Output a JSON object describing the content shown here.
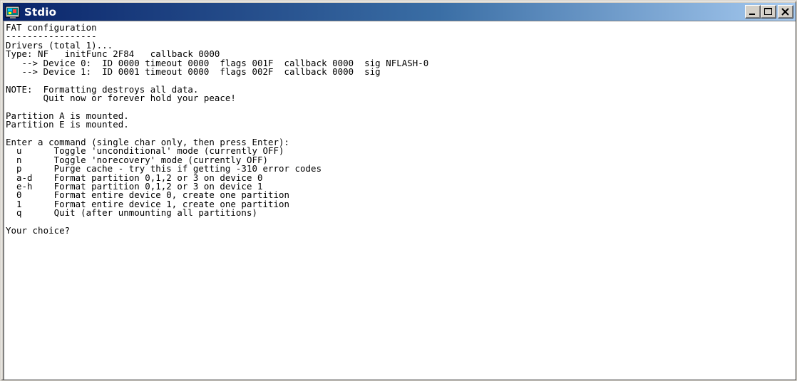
{
  "window": {
    "title": "Stdio",
    "icon": "console-app-icon",
    "controls": {
      "minimize": "minimize-icon",
      "maximize": "maximize-icon",
      "close": "close-icon"
    },
    "colors": {
      "titlebar_start": "#0a246a",
      "titlebar_end": "#a6caf0",
      "chrome": "#d4d0c8",
      "console_bg": "#ffffff",
      "console_text": "#000000"
    }
  },
  "console": {
    "lines": [
      "FAT configuration",
      "-----------------",
      "Drivers (total 1)...",
      "Type: NF   initFunc 2F84   callback 0000",
      "   --> Device 0:  ID 0000 timeout 0000  flags 001F  callback 0000  sig NFLASH-0",
      "   --> Device 1:  ID 0001 timeout 0000  flags 002F  callback 0000  sig",
      "",
      "NOTE:  Formatting destroys all data.",
      "       Quit now or forever hold your peace!",
      "",
      "Partition A is mounted.",
      "Partition E is mounted.",
      "",
      "Enter a command (single char only, then press Enter):",
      "  u      Toggle 'unconditional' mode (currently OFF)",
      "  n      Toggle 'norecovery' mode (currently OFF)",
      "  p      Purge cache - try this if getting -310 error codes",
      "  a-d    Format partition 0,1,2 or 3 on device 0",
      "  e-h    Format partition 0,1,2 or 3 on device 1",
      "  0      Format entire device 0, create one partition",
      "  1      Format entire device 1, create one partition",
      "  q      Quit (after unmounting all partitions)",
      "",
      "Your choice?"
    ]
  }
}
